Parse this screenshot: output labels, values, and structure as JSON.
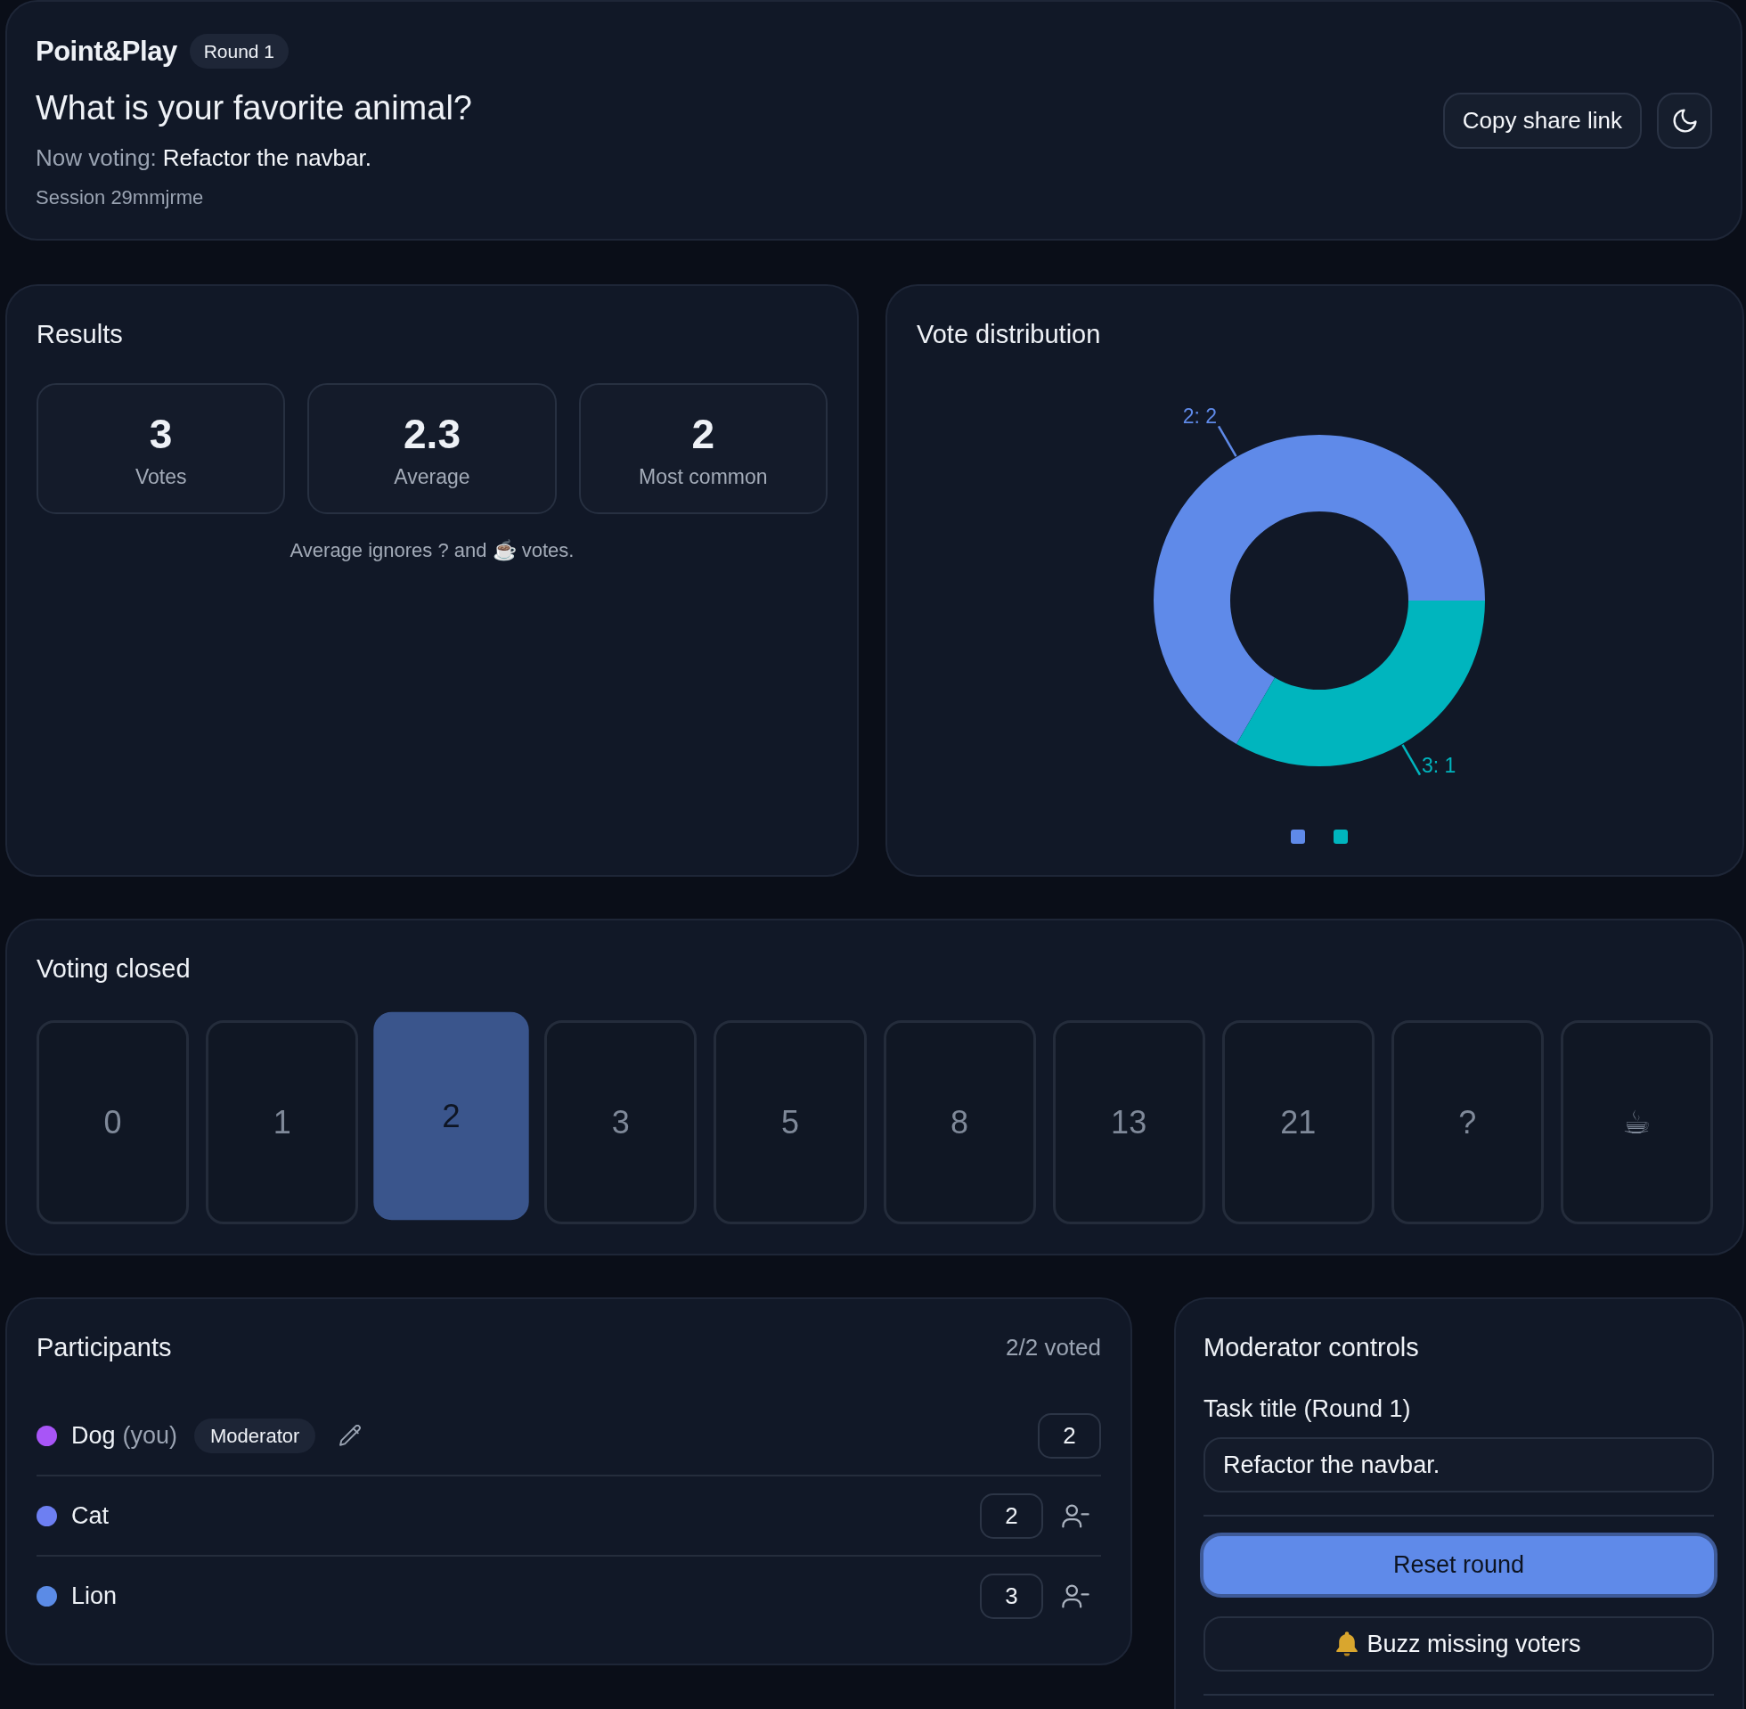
{
  "header": {
    "brand": "Point&Play",
    "round_badge": "Round 1",
    "title": "What is your favorite animal?",
    "now_voting": {
      "label": "Now voting:",
      "task": "Refactor the navbar."
    },
    "session": "Session 29mmjrme",
    "buttons": [
      {
        "kind": "share",
        "label": "Copy share link"
      },
      {
        "kind": "theme"
      }
    ]
  },
  "results": {
    "title": "Results",
    "stats": [
      {
        "value": "3",
        "label": "Votes"
      },
      {
        "value": "2.3",
        "label": "Average"
      },
      {
        "value": "2",
        "label": "Most common"
      }
    ],
    "note": "Average ignores ? and ☕ votes."
  },
  "vote_distribution": {
    "title": "Vote distribution",
    "chart_data": {
      "type": "donut",
      "values": [
        2,
        1
      ],
      "value_labels": [
        "2: 2",
        "3: 1"
      ]
    },
    "legend": [
      {
        "color": "#5f8ae9"
      },
      {
        "color": "#00b5be"
      }
    ]
  },
  "voting": {
    "title": "Voting closed",
    "cards": [
      {
        "label": "0",
        "selected": false,
        "disabled": true
      },
      {
        "label": "1",
        "selected": false,
        "disabled": true
      },
      {
        "label": "2",
        "selected": true,
        "disabled": true
      },
      {
        "label": "3",
        "selected": false,
        "disabled": true
      },
      {
        "label": "5",
        "selected": false,
        "disabled": true
      },
      {
        "label": "8",
        "selected": false,
        "disabled": true
      },
      {
        "label": "13",
        "selected": false,
        "disabled": true
      },
      {
        "label": "21",
        "selected": false,
        "disabled": true
      },
      {
        "label": "?",
        "selected": false,
        "disabled": true
      },
      {
        "label": "☕",
        "selected": false,
        "disabled": true
      }
    ]
  },
  "participants": {
    "title": "Participants",
    "summary": "2/2 voted",
    "rows": [
      {
        "kind": "self",
        "name": "Dog",
        "suffix": "(you)",
        "badge": "Moderator",
        "vote": "2",
        "color": "#a855f7"
      },
      {
        "kind": "member",
        "name": "Cat",
        "vote": "2",
        "color": "#6d7ff2"
      },
      {
        "kind": "member",
        "name": "Lion",
        "vote": "3",
        "color": "#5b8be6"
      }
    ]
  },
  "moderator": {
    "title": "Moderator controls",
    "field": {
      "label": "Task title (Round 1)",
      "value": "Refactor the navbar."
    },
    "buttons": [
      {
        "kind": "primary",
        "label": "Reset round"
      },
      {
        "kind": "buzz",
        "label": "Buzz missing voters"
      }
    ]
  }
}
